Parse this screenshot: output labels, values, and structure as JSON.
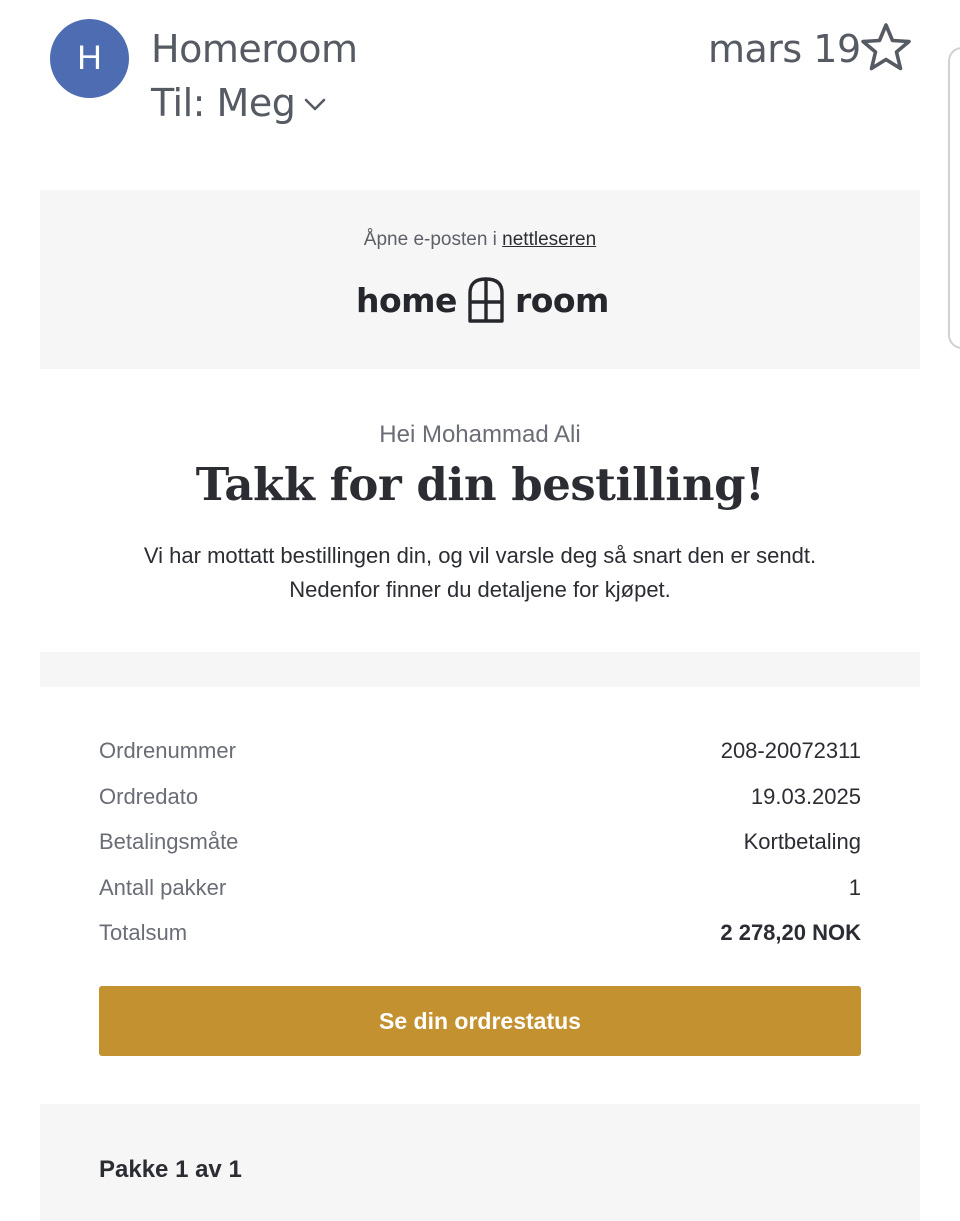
{
  "mail_header": {
    "avatar_letter": "H",
    "sender": "Homeroom",
    "recipient": "Til: Meg",
    "date": "mars 19"
  },
  "banner": {
    "open_prefix": "Åpne e-posten i ",
    "open_link": "nettleseren",
    "logo_left": "home",
    "logo_right": "room"
  },
  "message": {
    "greeting": "Hei Mohammad Ali",
    "headline": "Takk for din bestilling!",
    "intro_line1": "Vi har mottatt bestillingen din, og vil varsle deg så snart den er sendt.",
    "intro_line2": "Nedenfor finner du detaljene for kjøpet."
  },
  "order_summary": [
    {
      "label": "Ordrenummer",
      "value": "208-20072311"
    },
    {
      "label": "Ordredato",
      "value": "19.03.2025"
    },
    {
      "label": "Betalingsmåte",
      "value": "Kortbetaling"
    },
    {
      "label": "Antall pakker",
      "value": "1"
    },
    {
      "label": "Totalsum",
      "value": "2 278,20 NOK"
    }
  ],
  "cta_label": "Se din ordrestatus",
  "package": {
    "title": "Pakke 1 av 1"
  },
  "colors": {
    "avatar": "#4e6cb2",
    "cta": "#c3912f",
    "panel": "#f6f6f6"
  }
}
